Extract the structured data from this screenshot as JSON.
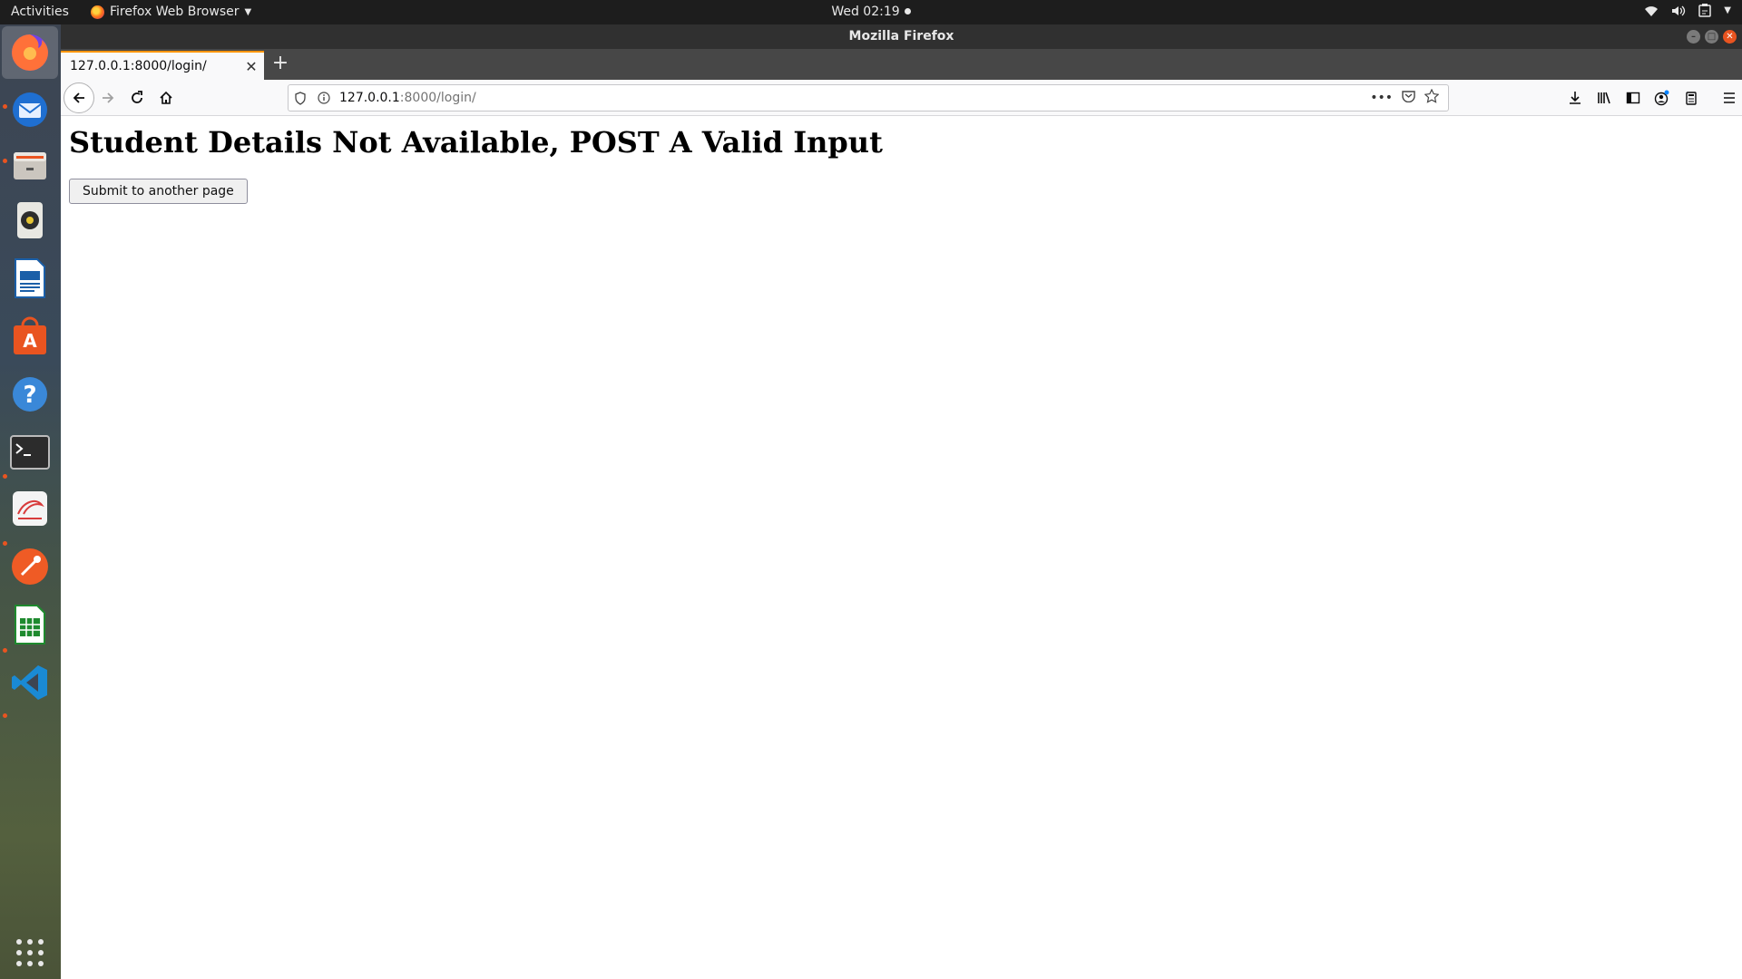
{
  "topbar": {
    "activities": "Activities",
    "app_name": "Firefox Web Browser",
    "clock": "Wed 02:19"
  },
  "dock": {
    "items": [
      "firefox-icon",
      "thunderbird-icon",
      "files-icon",
      "rhythmbox-icon",
      "writer-icon",
      "software-icon",
      "help-icon",
      "terminal-icon",
      "mailreader-icon",
      "postman-icon",
      "calc-icon",
      "vscode-icon",
      "app-grid-icon"
    ]
  },
  "window": {
    "title": "Mozilla Firefox"
  },
  "tab": {
    "title": "127.0.0.1:8000/login/"
  },
  "urlbar": {
    "host": "127.0.0.1",
    "rest": ":8000/login/"
  },
  "page": {
    "heading": "Student Details Not Available, POST A Valid Input",
    "button_label": "Submit to another page"
  }
}
